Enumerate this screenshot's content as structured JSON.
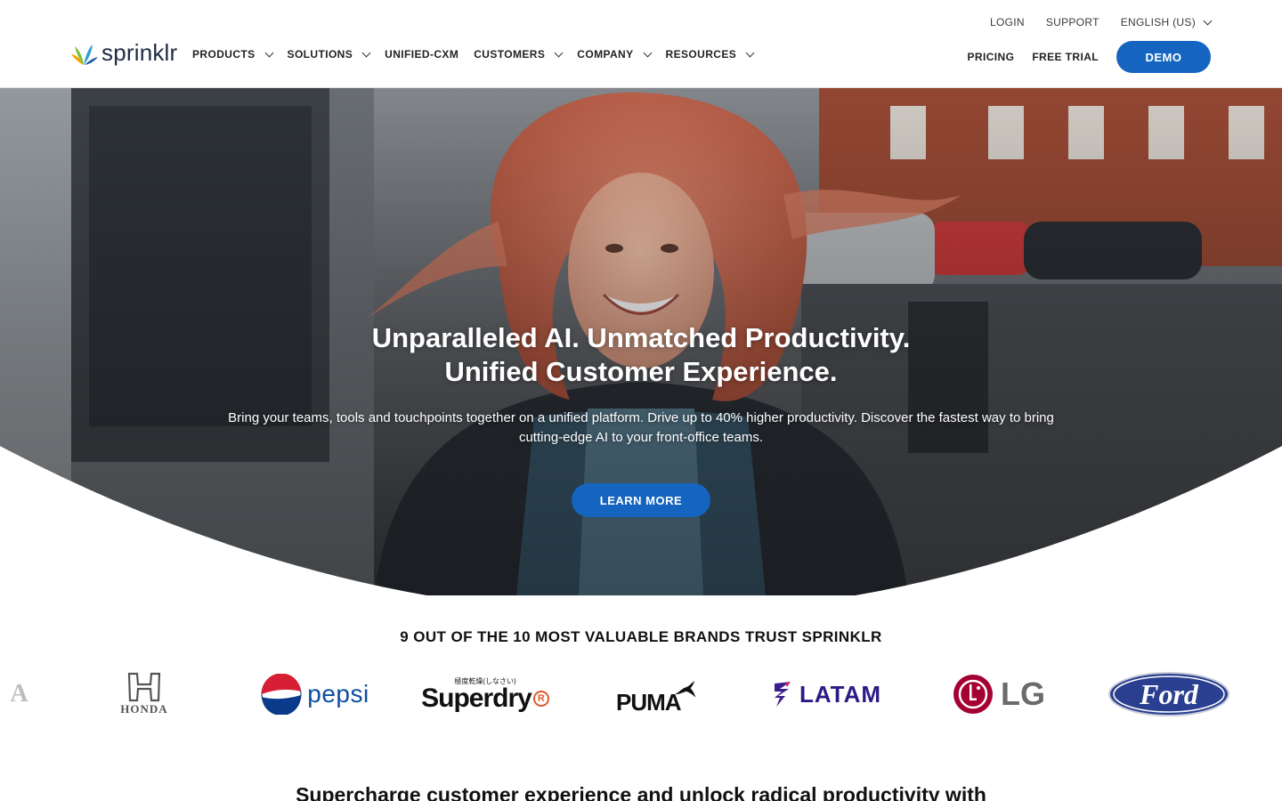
{
  "header": {
    "logo_text": "sprinklr",
    "utility": {
      "login": "LOGIN",
      "support": "SUPPORT",
      "language": "ENGLISH (US)"
    },
    "nav": [
      {
        "label": "PRODUCTS",
        "has_dropdown": true
      },
      {
        "label": "SOLUTIONS",
        "has_dropdown": true
      },
      {
        "label": "UNIFIED-CXM",
        "has_dropdown": false
      },
      {
        "label": "CUSTOMERS",
        "has_dropdown": true
      },
      {
        "label": "COMPANY",
        "has_dropdown": true
      },
      {
        "label": "RESOURCES",
        "has_dropdown": true
      }
    ],
    "pricing": "PRICING",
    "free_trial": "FREE TRIAL",
    "demo": "DEMO"
  },
  "hero": {
    "title_line1": "Unparalleled AI. Unmatched Productivity.",
    "title_line2": "Unified Customer Experience.",
    "subtitle": "Bring your teams, tools and touchpoints together on a unified platform. Drive up to 40% higher productivity. Discover the fastest way to bring cutting-edge AI to your front-office teams.",
    "cta": "LEARN MORE"
  },
  "brands": {
    "title": "9 OUT OF THE 10 MOST VALUABLE BRANDS TRUST SPRINKLR",
    "logos": [
      {
        "name": "partial",
        "text": "A"
      },
      {
        "name": "honda",
        "text": "HONDA"
      },
      {
        "name": "pepsi",
        "text": "pepsi"
      },
      {
        "name": "superdry",
        "text": "Superdry",
        "kana": "極度乾燥(しなさい)"
      },
      {
        "name": "puma",
        "text": "PUMA"
      },
      {
        "name": "latam",
        "text": "LATAM"
      },
      {
        "name": "lg",
        "text": "LG"
      },
      {
        "name": "ford",
        "text": "Ford"
      }
    ]
  },
  "section": {
    "title": "Supercharge customer experience and unlock radical productivity with"
  },
  "colors": {
    "primary_button": "#1565c0",
    "text_dark": "#1b1b1b"
  }
}
